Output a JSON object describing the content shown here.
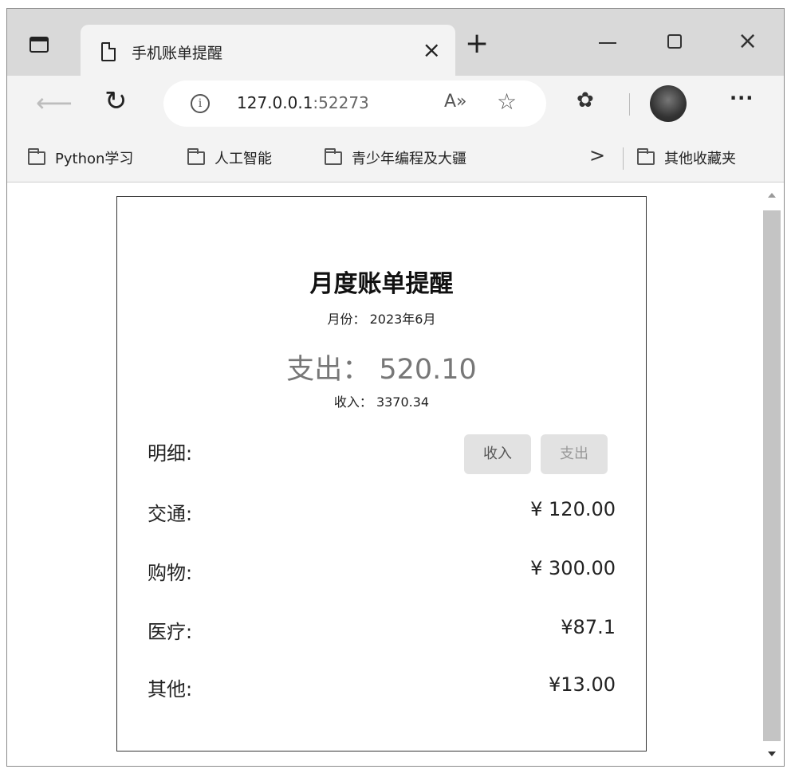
{
  "browser": {
    "tab_title": "手机账单提醒",
    "tab_close": "×",
    "new_tab": "+",
    "window_close": "×",
    "url_host": "127.0.0.1",
    "url_port": ":52273",
    "read_aloud_icon": "A»",
    "more_label": "···"
  },
  "favorites": {
    "items": [
      "Python学习",
      "人工智能",
      "青少年编程及大疆"
    ],
    "overflow": ">",
    "other": "其他收藏夹"
  },
  "bill": {
    "title": "月度账单提醒",
    "month": "月份： 2023年6月",
    "expense": "支出： 520.10",
    "income": "收入： 3370.34",
    "detail_label": "明细:",
    "income_button": "收入",
    "expense_button": "支出",
    "items": [
      {
        "label": "交通:",
        "amount": "¥ 120.00"
      },
      {
        "label": "购物:",
        "amount": "¥ 300.00"
      },
      {
        "label": "医疗:",
        "amount": "¥87.1"
      },
      {
        "label": "其他:",
        "amount": "¥13.00"
      }
    ]
  },
  "icons": {
    "tab_actions": "tab-actions-icon",
    "page": "page-icon",
    "back": "back-arrow-icon",
    "reload": "reload-icon",
    "info": "info-icon",
    "favorite": "add-favorite-icon",
    "extensions": "extensions-icon",
    "profile": "profile-avatar-icon",
    "folder": "folder-icon"
  }
}
